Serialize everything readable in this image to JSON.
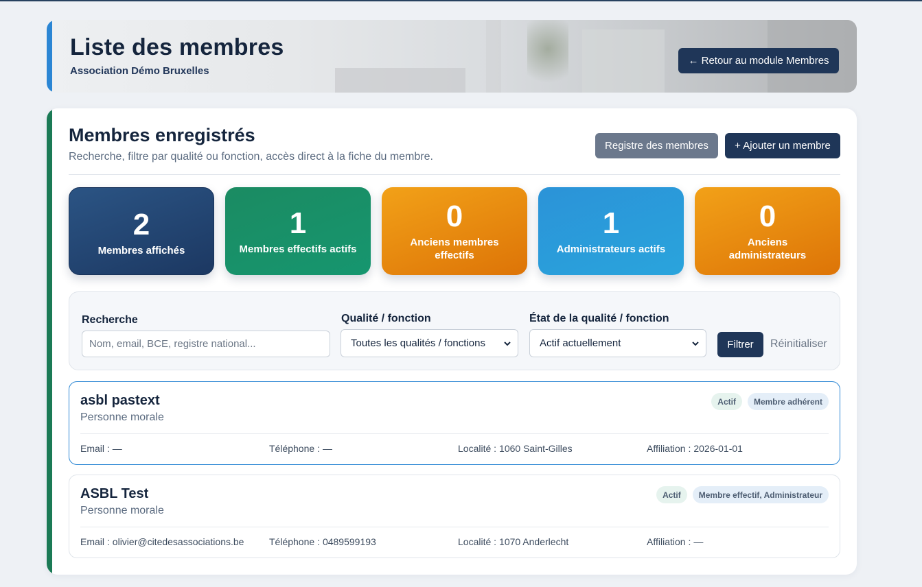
{
  "header": {
    "title": "Liste des membres",
    "subtitle": "Association Démo Bruxelles",
    "back_button": "← Retour au module Membres"
  },
  "section": {
    "title": "Membres enregistrés",
    "description": "Recherche, filtre par qualité ou fonction, accès direct à la fiche du membre.",
    "registry_button": "Registre des membres",
    "add_button": "+ Ajouter un membre"
  },
  "stats": [
    {
      "value": "2",
      "label": "Membres affichés"
    },
    {
      "value": "1",
      "label": "Membres effectifs actifs"
    },
    {
      "value": "0",
      "label": "Anciens membres effectifs"
    },
    {
      "value": "1",
      "label": "Administrateurs actifs"
    },
    {
      "value": "0",
      "label": "Anciens administrateurs"
    }
  ],
  "filters": {
    "search_label": "Recherche",
    "search_placeholder": "Nom, email, BCE, registre national...",
    "search_value": "",
    "quality_label": "Qualité / fonction",
    "quality_selected": "Toutes les qualités / fonctions",
    "state_label": "État de la qualité / fonction",
    "state_selected": "Actif actuellement",
    "filter_button": "Filtrer",
    "reset_link": "Réinitialiser"
  },
  "members": [
    {
      "name": "asbl pastext",
      "type": "Personne morale",
      "badges": [
        "Actif",
        "Membre adhérent"
      ],
      "email_label": "Email :",
      "email": "—",
      "phone_label": "Téléphone :",
      "phone": "—",
      "locality_label": "Localité :",
      "locality": "1060 Saint-Gilles",
      "affiliation_label": "Affiliation :",
      "affiliation": "2026-01-01"
    },
    {
      "name": "ASBL Test",
      "type": "Personne morale",
      "badges": [
        "Actif",
        "Membre effectif, Administrateur"
      ],
      "email_label": "Email :",
      "email": "olivier@citedesassociations.be",
      "phone_label": "Téléphone :",
      "phone": "0489599193",
      "locality_label": "Localité :",
      "locality": "1070 Anderlecht",
      "affiliation_label": "Affiliation :",
      "affiliation": "—"
    }
  ],
  "colors": {
    "navy": "#1f3658",
    "header_accent": "#2b86d4",
    "card_accent": "#1b7a55",
    "stat_navy": "#1c3862",
    "stat_green": "#16966f",
    "stat_orange": "#dd7407",
    "stat_blue": "#2aa4dc"
  },
  "icons": {
    "select_arrow": "chevron-down-icon"
  }
}
